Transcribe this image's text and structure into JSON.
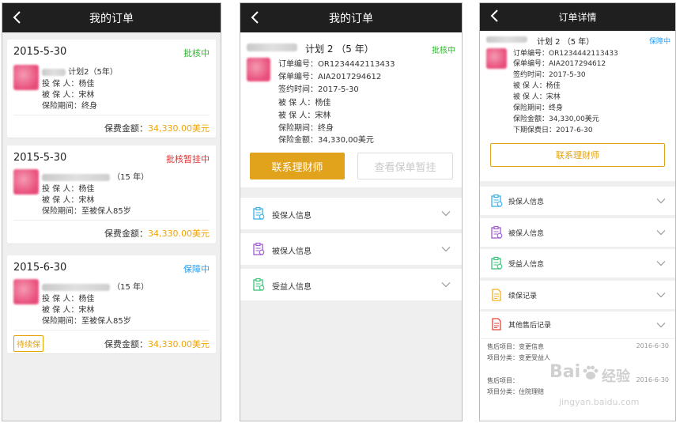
{
  "colors": {
    "gold": "#e1a31b",
    "green": "#2eb82e",
    "red": "#e03030",
    "blue": "#2a9df4",
    "amount": "#f0a30a"
  },
  "screen1": {
    "title": "我的订单",
    "orders": [
      {
        "date": "2015-5-30",
        "status": "批核中",
        "status_color": "#2eb82e",
        "plan": "计划2（5年）",
        "holder": "投 保 人：杨佳",
        "insured": "被 保 人：宋林",
        "period": "保险期间：终身",
        "fee_label": "保费金额：",
        "fee_amount": "34,330.00美元",
        "tag": ""
      },
      {
        "date": "2015-5-30",
        "status": "批核暂挂中",
        "status_color": "#e03030",
        "plan": "（15 年）",
        "holder": "投 保 人：杨佳",
        "insured": "被 保 人：宋林",
        "period": "保险期间：至被保人85岁",
        "fee_label": "保费金额：",
        "fee_amount": "34,330.00美元",
        "tag": ""
      },
      {
        "date": "2015-6-30",
        "status": "保障中",
        "status_color": "#2a9df4",
        "plan": "（15 年）",
        "holder": "投 保 人：杨佳",
        "insured": "被 保 人：宋林",
        "period": "保险期间：至被保人85岁",
        "fee_label": "保费金额：",
        "fee_amount": "34,330.00美元",
        "tag": "待续保"
      }
    ]
  },
  "screen2": {
    "title": "我的订单",
    "plan": "计划 2 （5 年）",
    "status": "批核中",
    "fields": [
      "订单编号：OR1234442113433",
      "保单编号：AIA2017294612",
      "签约时间：2017-5-30",
      "被 保 人：杨佳",
      "被 保 人：宋林",
      "保险期间：终身",
      "保险金额：34,330,00美元"
    ],
    "contact_button": "联系理财师",
    "view_button": "查看保单暂挂",
    "sections": [
      {
        "label": "投保人信息",
        "icon": "clipboard-icon",
        "color": "#3cb0e6"
      },
      {
        "label": "被保人信息",
        "icon": "clipboard-icon",
        "color": "#a05ad2"
      },
      {
        "label": "受益人信息",
        "icon": "clipboard-icon",
        "color": "#3cc47a"
      }
    ]
  },
  "screen3": {
    "title": "订单详情",
    "plan": "计划 2 （5 年）",
    "status": "保障中",
    "fields": [
      "订单编号：OR1234442113433",
      "保单编号：AIA2017294612",
      "签约时间：2017-5-30",
      "被 保 人：杨佳",
      "被 保 人：宋林",
      "保险期间：终身",
      "保险金额：34,330,00美元",
      "下期保费日：2017-6-30"
    ],
    "contact_button": "联系理财师",
    "sections": [
      {
        "label": "投保人信息",
        "icon": "clipboard-icon",
        "color": "#3cb0e6"
      },
      {
        "label": "被保人信息",
        "icon": "clipboard-icon",
        "color": "#a05ad2"
      },
      {
        "label": "受益人信息",
        "icon": "clipboard-icon",
        "color": "#3cc47a"
      },
      {
        "label": "续保记录",
        "icon": "document-icon",
        "color": "#f2b21d"
      },
      {
        "label": "其他售后记录",
        "icon": "document-icon",
        "color": "#e6453a"
      }
    ],
    "records": [
      {
        "item": "售后项目：变更信息",
        "category": "项目分类：变更受益人",
        "date": "2016-6-30"
      },
      {
        "item": "售后项目：",
        "category": "项目分类：住院理赔",
        "date": "2016-6-30"
      }
    ],
    "watermark": {
      "brand": "Bai",
      "brand2": "经验",
      "url": "jingyan.baidu.com"
    }
  }
}
